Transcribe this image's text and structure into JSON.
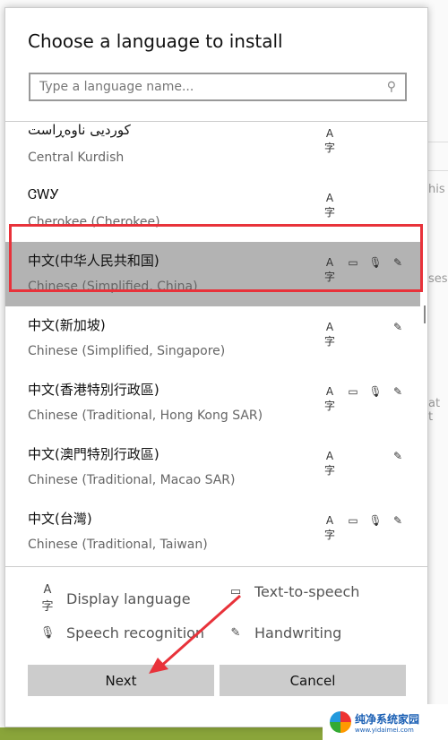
{
  "dialog": {
    "title": "Choose a language to install",
    "search_placeholder": "Type a language name..."
  },
  "background_fragments": [
    "his",
    "ses",
    "at t"
  ],
  "languages": [
    {
      "native": "کوردیی ناوەڕاست",
      "english": "Central Kurdish",
      "features": [
        "display-language"
      ]
    },
    {
      "native": "ᏣᎳᎩ",
      "english": "Cherokee (Cherokee)",
      "features": [
        "display-language"
      ]
    },
    {
      "native": "中文(中华人民共和国)",
      "english": "Chinese (Simplified, China)",
      "features": [
        "display-language",
        "text-to-speech",
        "speech-recognition",
        "handwriting"
      ],
      "selected": true
    },
    {
      "native": "中文(新加坡)",
      "english": "Chinese (Simplified, Singapore)",
      "features": [
        "display-language",
        "handwriting"
      ]
    },
    {
      "native": "中文(香港特別行政區)",
      "english": "Chinese (Traditional, Hong Kong SAR)",
      "features": [
        "display-language",
        "text-to-speech",
        "speech-recognition",
        "handwriting"
      ]
    },
    {
      "native": "中文(澳門特別行政區)",
      "english": "Chinese (Traditional, Macao SAR)",
      "features": [
        "display-language",
        "handwriting"
      ]
    },
    {
      "native": "中文(台灣)",
      "english": "Chinese (Traditional, Taiwan)",
      "features": [
        "display-language",
        "text-to-speech",
        "speech-recognition",
        "handwriting"
      ]
    }
  ],
  "legend": {
    "display": "Display language",
    "tts": "Text-to-speech",
    "speech": "Speech recognition",
    "handwriting": "Handwriting"
  },
  "buttons": {
    "next": "Next",
    "cancel": "Cancel"
  },
  "highlight_color": "#e8323a",
  "watermark": {
    "name": "纯净系统家园",
    "url": "www.yidaimei.com"
  }
}
